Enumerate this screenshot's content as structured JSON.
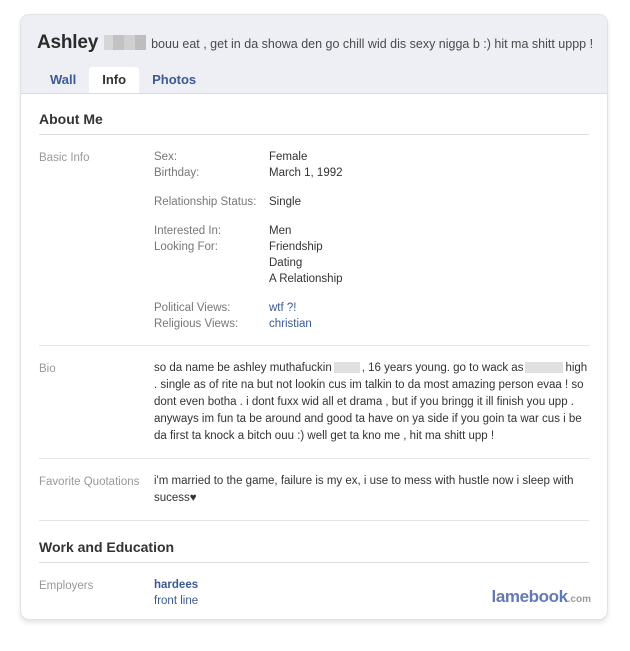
{
  "profile": {
    "name": "Ashley",
    "name_redacted": true,
    "status": "bouu eat , get in da showa den go chill wid dis sexy nigga b :) hit ma shitt uppp !"
  },
  "tabs": [
    {
      "label": "Wall",
      "active": false
    },
    {
      "label": "Info",
      "active": true
    },
    {
      "label": "Photos",
      "active": false
    }
  ],
  "sections": {
    "about_me": {
      "title": "About Me",
      "basic_info": {
        "label": "Basic Info",
        "groups": [
          {
            "fields": [
              {
                "key": "Sex:",
                "value": "Female"
              },
              {
                "key": "Birthday:",
                "value": "March 1, 1992"
              }
            ]
          },
          {
            "fields": [
              {
                "key": "Relationship Status:",
                "value": "Single"
              }
            ]
          },
          {
            "fields": [
              {
                "key": "Interested In:",
                "value": "Men"
              },
              {
                "key": "Looking For:",
                "value": "Friendship"
              }
            ],
            "extra_values": [
              "Dating",
              "A Relationship"
            ]
          },
          {
            "fields": [
              {
                "key": "Political Views:",
                "value": "wtf ?!",
                "is_link": true
              },
              {
                "key": "Religious Views:",
                "value": "christian",
                "is_link": true
              }
            ]
          }
        ]
      },
      "bio": {
        "label": "Bio",
        "text_part_1": "so da name be ashley muthafuckin",
        "text_part_2": ", 16 years young. go to wack as",
        "text_part_3": "high . single as of rite na but not lookin cus im talkin to da most amazing person evaa ! so dont even botha . i dont fuxx wid all et drama , but if you bringg it ill finish you upp . anyways im fun ta be around and good ta have on ya side if you goin ta war cus i be da first ta knock a bitch ouu :) well get ta kno me , hit ma shitt upp !"
      },
      "favorite_quotations": {
        "label": "Favorite Quotations",
        "text": "i'm married to the game, failure is my ex, i use to mess with hustle now i sleep with sucess♥"
      }
    },
    "work_and_education": {
      "title": "Work and Education",
      "employers": {
        "label": "Employers",
        "name": "hardees",
        "role": "front line"
      }
    }
  },
  "watermark": {
    "brand": "lamebook",
    "tld": ".com"
  },
  "colors": {
    "facebook_blue": "#3b5998",
    "header_band": "#edeff4",
    "label_gray": "#999999",
    "watermark_blue": "#6379b5"
  }
}
